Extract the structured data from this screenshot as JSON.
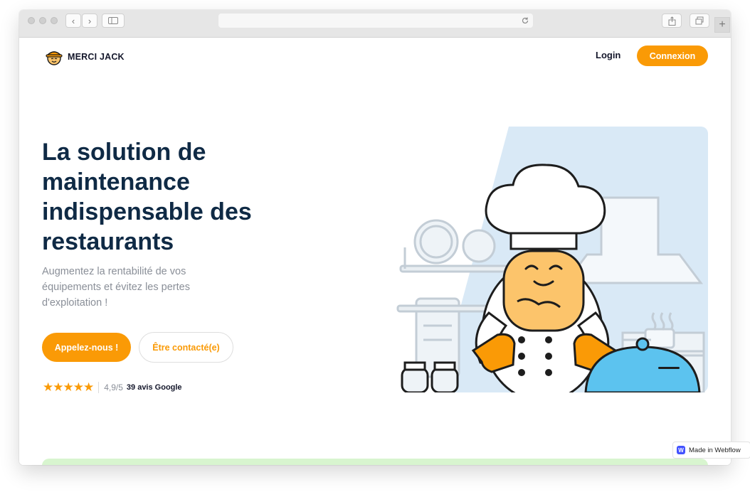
{
  "nav": {
    "brand": "MERCI JACK",
    "login_label": "Login",
    "connexion_label": "Connexion"
  },
  "hero": {
    "title": "La solution de maintenance indispensable des restaurants",
    "subtitle": "Augmentez la rentabilité de vos équipements et évitez les pertes d'exploitation !",
    "cta_call": "Appelez-nous !",
    "cta_contact": "Être contacté(e)"
  },
  "rating": {
    "stars": "★★★★★",
    "star_count": 5,
    "score": "4,9/5",
    "reviews": "39 avis Google"
  },
  "badge": {
    "icon_letter": "W",
    "label": "Made in Webflow"
  },
  "colors": {
    "accent": "#fa9a06",
    "heading": "#0f2a45",
    "muted": "#8a8f98",
    "illustration_bg": "#d9e9f6",
    "strip": "#d8f5cf"
  },
  "icons": [
    "back-icon",
    "forward-icon",
    "sidebar-icon",
    "reload-icon",
    "share-icon",
    "tabs-icon",
    "new-tab-icon",
    "logo-icon",
    "star-icon",
    "webflow-icon"
  ]
}
